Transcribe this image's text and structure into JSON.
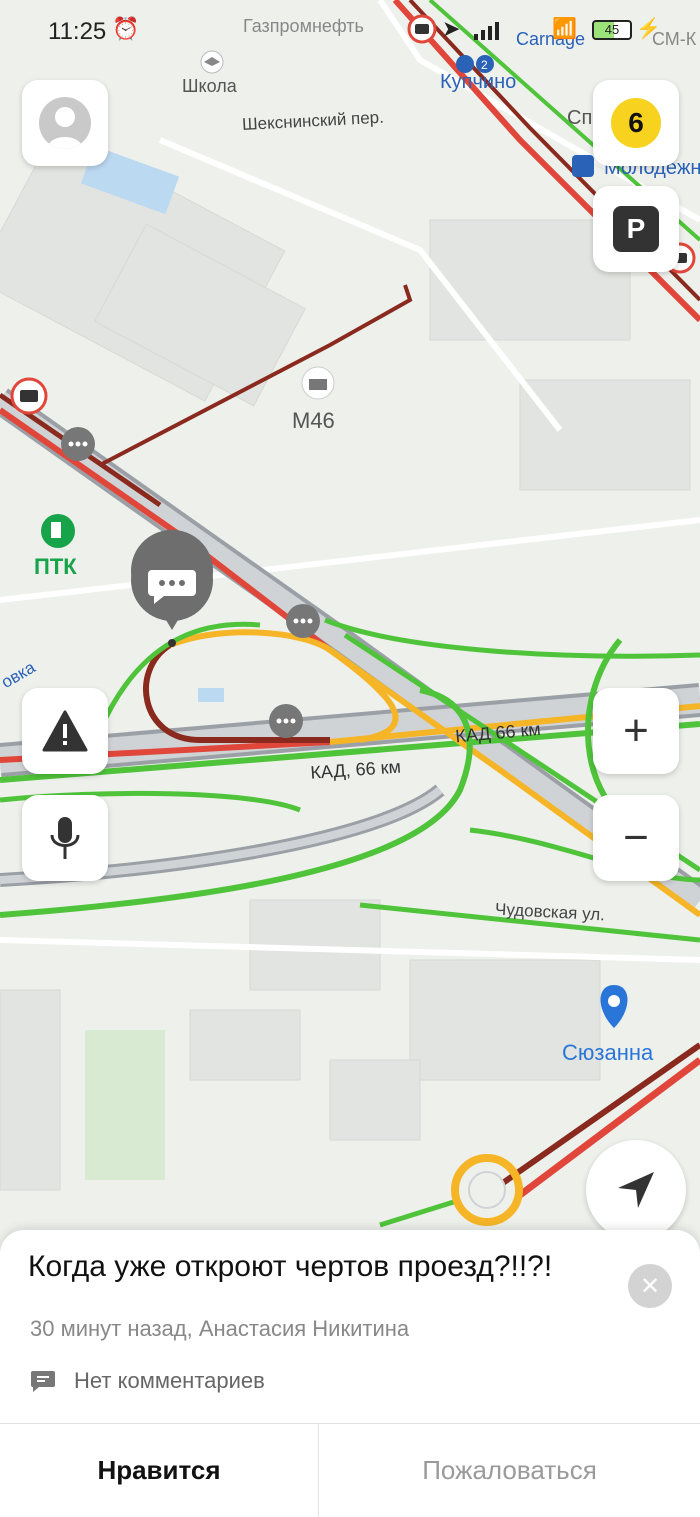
{
  "status_bar": {
    "time": "11:25",
    "battery": "45"
  },
  "map": {
    "labels": {
      "gazpromneft": "Газпромнефть",
      "school": "Школа",
      "kupchino": "Купчино",
      "metro_line": "2",
      "sheksninsky": "Шекснинский пер.",
      "molodezhnaya": "Молодёжн",
      "sp": "Сп",
      "sm": "СМ-К",
      "carnage": "Carnage",
      "m46": "М46",
      "ptk": "ПТК",
      "kad_upper": "КАД 66 км",
      "kad_lower": "КАД, 66 км",
      "chudovskaya": "Чудовская ул.",
      "suzanna": "Сюзанна",
      "ovka": "овка"
    },
    "traffic_level": "6",
    "parking_label": "P",
    "zoom_in": "+",
    "zoom_out": "−"
  },
  "colors": {
    "road_green": "#4fc43a",
    "road_red": "#e0463a",
    "road_darkred": "#8a2a1e",
    "road_yellow": "#f5b526",
    "ptk_green": "#16a34a",
    "suzanna_blue": "#2a76d8"
  },
  "sheet": {
    "title": "Когда уже откроют чертов проезд?!!?!",
    "meta": "30 минут назад, Анастасия Никитина",
    "comments": "Нет комментариев",
    "like": "Нравится",
    "report": "Пожаловаться"
  }
}
